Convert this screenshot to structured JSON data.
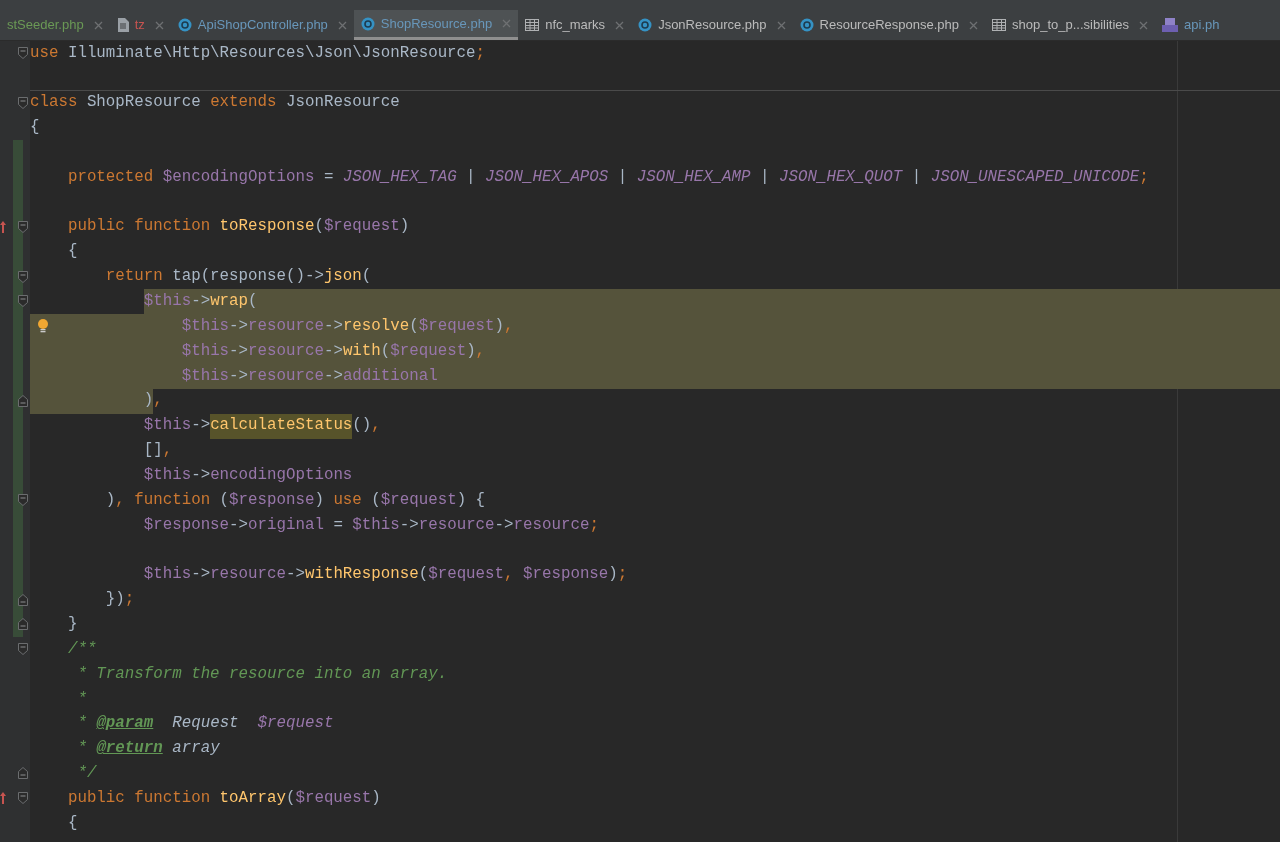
{
  "tabs": [
    {
      "label": "stSeeder.php",
      "color": "#6a9955",
      "selected": false,
      "closable": true
    },
    {
      "label": "tz",
      "kind": "text",
      "color": "#c75450",
      "selected": false,
      "closable": true
    },
    {
      "label": "ApiShopController.php",
      "kind": "class",
      "color": "#6897bb",
      "selected": false,
      "closable": true
    },
    {
      "label": "ShopResource.php",
      "kind": "class",
      "color": "#6897bb",
      "selected": true,
      "closable": true
    },
    {
      "label": "nfc_marks",
      "kind": "table",
      "color": "#bbbbbb",
      "selected": false,
      "closable": true
    },
    {
      "label": "JsonResource.php",
      "kind": "class",
      "color": "#bbbbbb",
      "selected": false,
      "closable": true
    },
    {
      "label": "ResourceResponse.php",
      "kind": "class",
      "color": "#bbbbbb",
      "selected": false,
      "closable": true
    },
    {
      "label": "shop_to_p...sibilities",
      "kind": "table",
      "color": "#bbbbbb",
      "selected": false,
      "closable": true
    },
    {
      "label": "api.ph",
      "kind": "php",
      "color": "#6897bb",
      "selected": false,
      "closable": false
    }
  ],
  "lines": [
    {
      "fold_start": true,
      "segments": [
        {
          "text": "use ",
          "kind": "keyword"
        },
        {
          "text": "Illuminate\\Http\\Resources\\Json\\JsonResource",
          "kind": "plain"
        },
        {
          "text": ";",
          "kind": "keyword"
        }
      ]
    },
    {
      "separator": true
    },
    {
      "fold_start": true,
      "segments": [
        {
          "text": "class ",
          "kind": "keyword"
        },
        {
          "text": "ShopResource ",
          "kind": "plain"
        },
        {
          "text": "extends ",
          "kind": "keyword"
        },
        {
          "text": "JsonResource",
          "kind": "plain"
        }
      ]
    },
    {
      "segments": [
        {
          "text": "{",
          "kind": "plain"
        }
      ]
    },
    {
      "changed": true
    },
    {
      "changed": true,
      "segments": [
        {
          "text": "    protected ",
          "kind": "keyword"
        },
        {
          "text": "$encodingOptions",
          "kind": "variable"
        },
        {
          "text": " = ",
          "kind": "plain"
        },
        {
          "text": "JSON_HEX_TAG",
          "kind": "constant"
        },
        {
          "text": " | ",
          "kind": "plain"
        },
        {
          "text": "JSON_HEX_APOS",
          "kind": "constant"
        },
        {
          "text": " | ",
          "kind": "plain"
        },
        {
          "text": "JSON_HEX_AMP",
          "kind": "constant"
        },
        {
          "text": " | ",
          "kind": "plain"
        },
        {
          "text": "JSON_HEX_QUOT",
          "kind": "constant"
        },
        {
          "text": " | ",
          "kind": "plain"
        },
        {
          "text": "JSON_UNESCAPED_UNICODE",
          "kind": "constant"
        },
        {
          "text": ";",
          "kind": "keyword"
        }
      ]
    },
    {
      "changed": true
    },
    {
      "changed": true,
      "fold_start": true,
      "override": true,
      "segments": [
        {
          "text": "    public function ",
          "kind": "keyword"
        },
        {
          "text": "toResponse",
          "kind": "method"
        },
        {
          "text": "(",
          "kind": "plain"
        },
        {
          "text": "$request",
          "kind": "variable"
        },
        {
          "text": ")",
          "kind": "plain"
        }
      ]
    },
    {
      "changed": true,
      "segments": [
        {
          "text": "    {",
          "kind": "plain"
        }
      ]
    },
    {
      "changed": true,
      "fold_start": true,
      "segments": [
        {
          "text": "        return ",
          "kind": "keyword"
        },
        {
          "text": "tap(response()->",
          "kind": "plain"
        },
        {
          "text": "json",
          "kind": "method"
        },
        {
          "text": "(",
          "kind": "plain"
        }
      ]
    },
    {
      "changed": true,
      "fold_start": true,
      "selected": true,
      "indent_selected": false,
      "segments": [
        {
          "text": "            $this",
          "kind": "variable"
        },
        {
          "text": "->",
          "kind": "plain"
        },
        {
          "text": "wrap",
          "kind": "method"
        },
        {
          "text": "(",
          "kind": "plain"
        }
      ]
    },
    {
      "changed": true,
      "bulb": true,
      "selected": true,
      "indent_selected": true,
      "segments": [
        {
          "text": "                $this",
          "kind": "variable"
        },
        {
          "text": "->",
          "kind": "plain"
        },
        {
          "text": "resource",
          "kind": "variable"
        },
        {
          "text": "->",
          "kind": "plain"
        },
        {
          "text": "resolve",
          "kind": "method"
        },
        {
          "text": "(",
          "kind": "plain"
        },
        {
          "text": "$request",
          "kind": "variable"
        },
        {
          "text": ")",
          "kind": "plain"
        },
        {
          "text": ",",
          "kind": "keyword"
        }
      ]
    },
    {
      "changed": true,
      "selected": true,
      "indent_selected": true,
      "segments": [
        {
          "text": "                $this",
          "kind": "variable"
        },
        {
          "text": "->",
          "kind": "plain"
        },
        {
          "text": "resource",
          "kind": "variable"
        },
        {
          "text": "->",
          "kind": "plain"
        },
        {
          "text": "with",
          "kind": "method"
        },
        {
          "text": "(",
          "kind": "plain"
        },
        {
          "text": "$request",
          "kind": "variable"
        },
        {
          "text": ")",
          "kind": "plain"
        },
        {
          "text": ",",
          "kind": "keyword"
        }
      ]
    },
    {
      "changed": true,
      "selected": true,
      "indent_selected": true,
      "segments": [
        {
          "text": "                $this",
          "kind": "variable"
        },
        {
          "text": "->",
          "kind": "plain"
        },
        {
          "text": "resource",
          "kind": "variable"
        },
        {
          "text": "->",
          "kind": "plain"
        },
        {
          "text": "additional",
          "kind": "variable"
        }
      ]
    },
    {
      "changed": true,
      "fold_end": true,
      "segments": [
        {
          "text": "            )",
          "kind": "plain",
          "selected": true
        },
        {
          "text": ",",
          "kind": "keyword",
          "selected": false
        }
      ]
    },
    {
      "changed": true,
      "segments": [
        {
          "text": "            $this",
          "kind": "variable"
        },
        {
          "text": "->",
          "kind": "plain"
        },
        {
          "text": "calculateStatus",
          "kind": "method",
          "marked": true
        },
        {
          "text": "()",
          "kind": "plain"
        },
        {
          "text": ",",
          "kind": "keyword"
        }
      ]
    },
    {
      "changed": true,
      "segments": [
        {
          "text": "            []",
          "kind": "plain"
        },
        {
          "text": ",",
          "kind": "keyword"
        }
      ]
    },
    {
      "changed": true,
      "segments": [
        {
          "text": "            $this",
          "kind": "variable"
        },
        {
          "text": "->",
          "kind": "plain"
        },
        {
          "text": "encodingOptions",
          "kind": "variable"
        }
      ]
    },
    {
      "changed": true,
      "fold_start": true,
      "segments": [
        {
          "text": "        )",
          "kind": "plain"
        },
        {
          "text": ", function ",
          "kind": "keyword"
        },
        {
          "text": "(",
          "kind": "plain"
        },
        {
          "text": "$response",
          "kind": "variable"
        },
        {
          "text": ") ",
          "kind": "plain"
        },
        {
          "text": "use ",
          "kind": "keyword"
        },
        {
          "text": "(",
          "kind": "plain"
        },
        {
          "text": "$request",
          "kind": "variable"
        },
        {
          "text": ") {",
          "kind": "plain"
        }
      ]
    },
    {
      "changed": true,
      "segments": [
        {
          "text": "            $response",
          "kind": "variable"
        },
        {
          "text": "->",
          "kind": "plain"
        },
        {
          "text": "original",
          "kind": "variable"
        },
        {
          "text": " = ",
          "kind": "plain"
        },
        {
          "text": "$this",
          "kind": "variable"
        },
        {
          "text": "->",
          "kind": "plain"
        },
        {
          "text": "resource",
          "kind": "variable"
        },
        {
          "text": "->",
          "kind": "plain"
        },
        {
          "text": "resource",
          "kind": "variable"
        },
        {
          "text": ";",
          "kind": "keyword"
        }
      ]
    },
    {
      "changed": true
    },
    {
      "changed": true,
      "segments": [
        {
          "text": "            $this",
          "kind": "variable"
        },
        {
          "text": "->",
          "kind": "plain"
        },
        {
          "text": "resource",
          "kind": "variable"
        },
        {
          "text": "->",
          "kind": "plain"
        },
        {
          "text": "withResponse",
          "kind": "method"
        },
        {
          "text": "(",
          "kind": "plain"
        },
        {
          "text": "$request",
          "kind": "variable"
        },
        {
          "text": ", ",
          "kind": "keyword"
        },
        {
          "text": "$response",
          "kind": "variable"
        },
        {
          "text": ")",
          "kind": "plain"
        },
        {
          "text": ";",
          "kind": "keyword"
        }
      ]
    },
    {
      "changed": true,
      "fold_end": true,
      "segments": [
        {
          "text": "        })",
          "kind": "plain"
        },
        {
          "text": ";",
          "kind": "keyword"
        }
      ]
    },
    {
      "changed": true,
      "fold_end": true,
      "segments": [
        {
          "text": "    }",
          "kind": "plain"
        }
      ]
    },
    {
      "fold_start": true,
      "segments": [
        {
          "text": "    /**",
          "kind": "comment"
        }
      ]
    },
    {
      "segments": [
        {
          "text": "     * Transform the resource into an array.",
          "kind": "comment"
        }
      ]
    },
    {
      "segments": [
        {
          "text": "     *",
          "kind": "comment"
        }
      ]
    },
    {
      "segments": [
        {
          "text": "     * ",
          "kind": "comment"
        },
        {
          "text": "@param",
          "kind": "doctag"
        },
        {
          "text": "  Request  ",
          "kind": "doctype"
        },
        {
          "text": "$request",
          "kind": "docvar"
        }
      ]
    },
    {
      "segments": [
        {
          "text": "     * ",
          "kind": "comment"
        },
        {
          "text": "@return",
          "kind": "doctag"
        },
        {
          "text": " array",
          "kind": "doctype"
        }
      ]
    },
    {
      "fold_end": true,
      "segments": [
        {
          "text": "     */",
          "kind": "comment"
        }
      ]
    },
    {
      "fold_start": true,
      "override": true,
      "segments": [
        {
          "text": "    public function ",
          "kind": "keyword"
        },
        {
          "text": "toArray",
          "kind": "method"
        },
        {
          "text": "(",
          "kind": "plain"
        },
        {
          "text": "$request",
          "kind": "variable"
        },
        {
          "text": ")",
          "kind": "plain"
        }
      ]
    },
    {
      "segments": [
        {
          "text": "    {",
          "kind": "plain"
        }
      ]
    }
  ]
}
